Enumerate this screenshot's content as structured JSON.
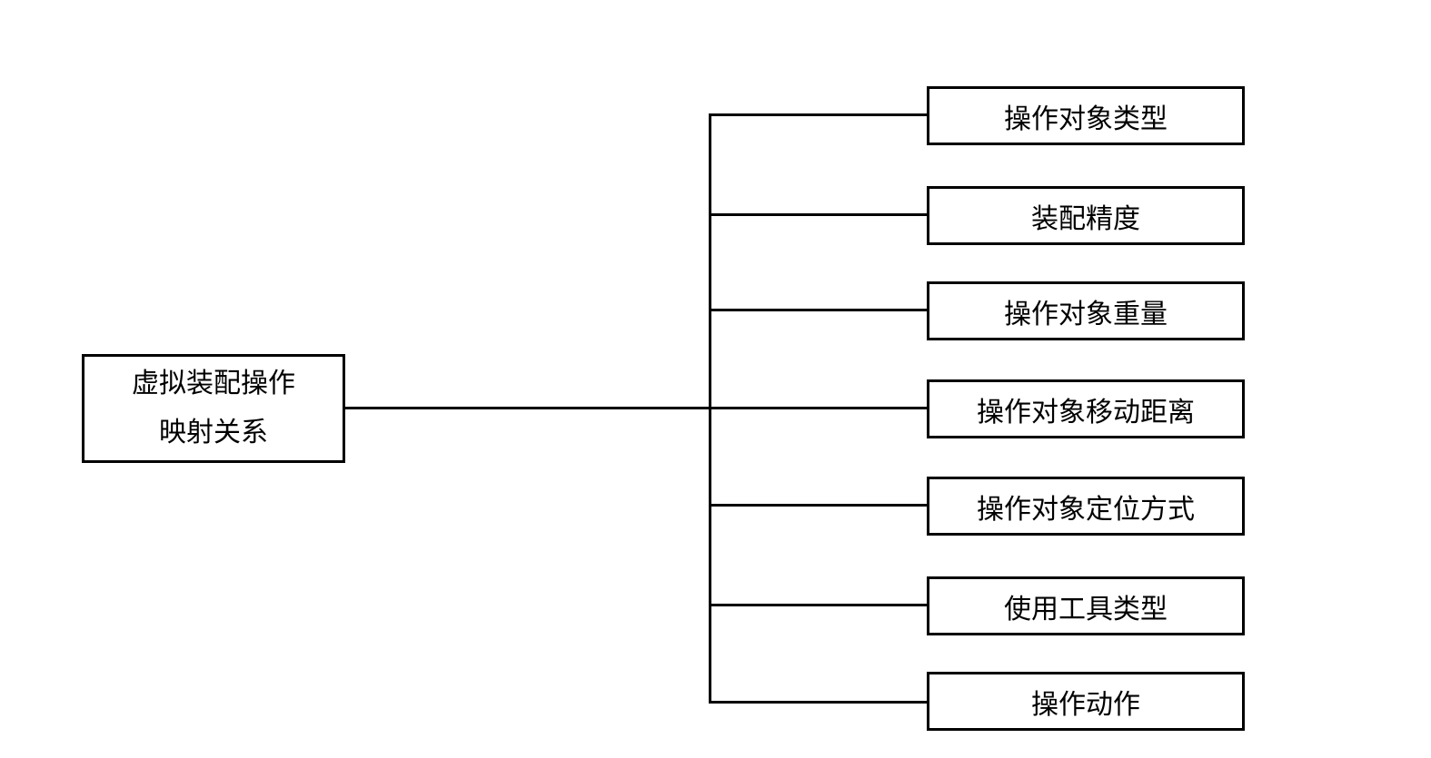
{
  "diagram": {
    "root": {
      "line1": "虚拟装配操作",
      "line2": "映射关系"
    },
    "children": [
      "操作对象类型",
      "装配精度",
      "操作对象重量",
      "操作对象移动距离",
      "操作对象定位方式",
      "使用工具类型",
      "操作动作"
    ]
  }
}
